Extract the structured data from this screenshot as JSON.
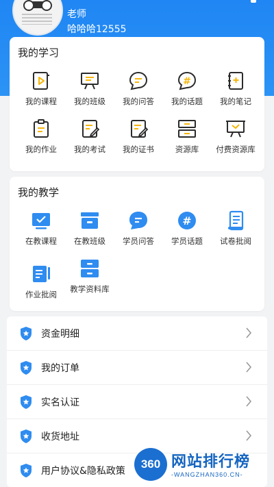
{
  "profile": {
    "role": "老师",
    "username": "哈哈哈12555"
  },
  "learning": {
    "title": "我的学习",
    "items": [
      {
        "label": "我的课程",
        "icon": "course-icon"
      },
      {
        "label": "我的班级",
        "icon": "class-icon"
      },
      {
        "label": "我的问答",
        "icon": "qa-icon"
      },
      {
        "label": "我的话题",
        "icon": "topic-icon"
      },
      {
        "label": "我的笔记",
        "icon": "notes-icon"
      },
      {
        "label": "我的作业",
        "icon": "homework-icon"
      },
      {
        "label": "我的考试",
        "icon": "exam-icon"
      },
      {
        "label": "我的证书",
        "icon": "certificate-icon"
      },
      {
        "label": "资源库",
        "icon": "resource-icon"
      },
      {
        "label": "付费资源库",
        "icon": "paid-resource-icon"
      }
    ]
  },
  "teaching": {
    "title": "我的教学",
    "items": [
      {
        "label": "在教课程",
        "icon": "teaching-course-icon"
      },
      {
        "label": "在教班级",
        "icon": "teaching-class-icon"
      },
      {
        "label": "学员问答",
        "icon": "student-qa-icon"
      },
      {
        "label": "学员话题",
        "icon": "student-topic-icon"
      },
      {
        "label": "试卷批阅",
        "icon": "paper-review-icon"
      },
      {
        "label": "作业批阅",
        "icon": "homework-review-icon"
      },
      {
        "label": "教学资料库",
        "icon": "teaching-library-icon"
      }
    ]
  },
  "menu": [
    {
      "label": "资金明细"
    },
    {
      "label": "我的订单"
    },
    {
      "label": "实名认证"
    },
    {
      "label": "收货地址"
    },
    {
      "label": "用户协议&隐私政策"
    }
  ],
  "watermark": {
    "badge": "360",
    "text": "网站排行榜",
    "sub": "-WANGZHAN360.CN-"
  },
  "colors": {
    "header": "#1f86f3",
    "learning_icon_stroke": "#2a2a2a",
    "learning_icon_accent": "#f5b50a",
    "teaching_icon": "#2f8cf0",
    "shield": "#2f8cf0"
  }
}
